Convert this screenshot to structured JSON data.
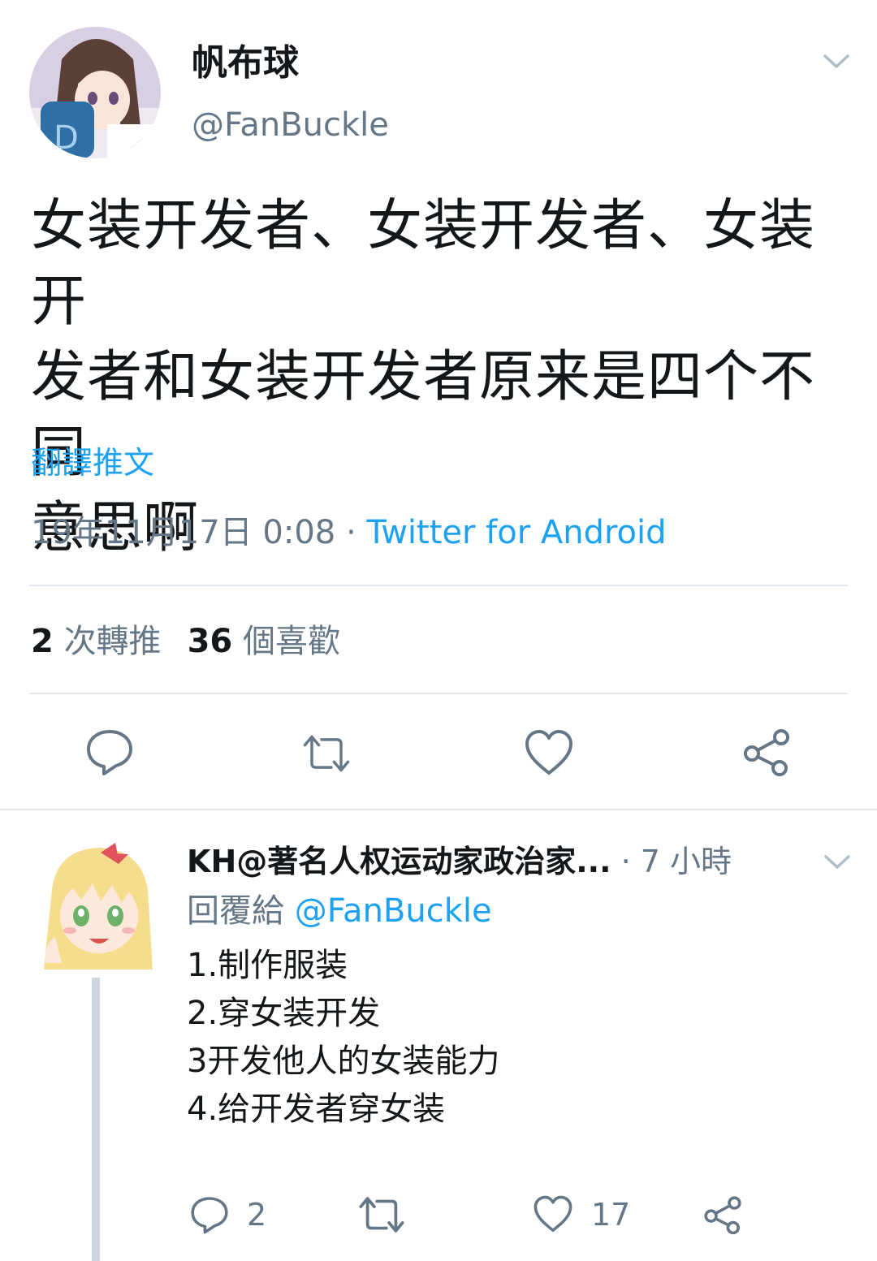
{
  "colors": {
    "link": "#1da1f2",
    "secondary_text": "#657786",
    "primary_text": "#14171a",
    "divider": "#e1e8ed",
    "thread_line": "#ccd6dd"
  },
  "tweet": {
    "display_name": "帆布球",
    "handle": "@FanBuckle",
    "text_lines": [
      "女装开发者、女装开发者、女装开",
      "发者和女装开发者原来是四个不同",
      "意思啊"
    ],
    "translate_label": "翻譯推文",
    "date_time": "19年11月17日 0:08",
    "separator": " · ",
    "source": "Twitter for Android",
    "retweet_count": "2",
    "retweet_label": "次轉推",
    "like_count": "36",
    "like_label": "個喜歡",
    "icons": [
      "reply-icon",
      "retweet-icon",
      "like-icon",
      "share-icon",
      "chevron-down-icon"
    ]
  },
  "reply": {
    "display_name": "KH@著名人权运动家政治家...",
    "time": " · 7 小時",
    "replying_label": "回覆給 ",
    "replying_to": "@FanBuckle",
    "lines": [
      "1.制作服装",
      "2.穿女装开发",
      "3开发他人的女装能力",
      "4.给开发者穿女装"
    ],
    "reply_count": "2",
    "like_count": "17",
    "icons": [
      "reply-icon",
      "retweet-icon",
      "like-icon",
      "share-icon",
      "chevron-down-icon"
    ]
  }
}
